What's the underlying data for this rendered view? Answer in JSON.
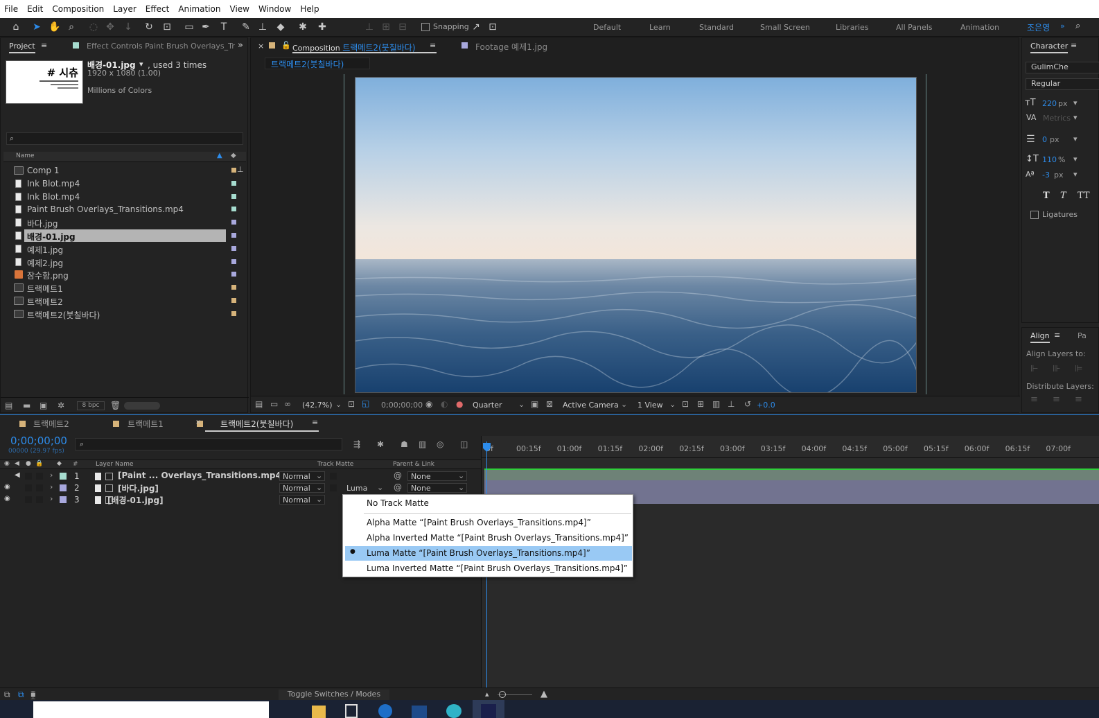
{
  "menu": [
    "File",
    "Edit",
    "Composition",
    "Layer",
    "Effect",
    "Animation",
    "View",
    "Window",
    "Help"
  ],
  "toolbar": {
    "snapping": "Snapping",
    "workspaces": [
      "Default",
      "Learn",
      "Standard",
      "Small Screen",
      "Libraries",
      "All Panels",
      "Animation"
    ],
    "user": "조은영"
  },
  "project": {
    "tab": "Project",
    "effect_tab": "Effect Controls Paint Brush Overlays_Tr",
    "thumb_title": "# 시츄",
    "file_name": "배경-01.jpg",
    "used": ", used 3 times",
    "dims": "1920 x 1080 (1.00)",
    "colors": "Millions of Colors",
    "col_name": "Name",
    "items": [
      {
        "name": "Comp 1",
        "color": "#d6b37a",
        "type": "comp"
      },
      {
        "name": "Ink Blot.mp4",
        "color": "#a6dccf",
        "type": "file"
      },
      {
        "name": "Ink Blot.mp4",
        "color": "#a6dccf",
        "type": "file"
      },
      {
        "name": "Paint Brush Overlays_Transitions.mp4",
        "color": "#a6dccf",
        "type": "file"
      },
      {
        "name": "바다.jpg",
        "color": "#a8a8dd",
        "type": "file"
      },
      {
        "name": "배경-01.jpg",
        "color": "#a8a8dd",
        "type": "file"
      },
      {
        "name": "예제1.jpg",
        "color": "#a8a8dd",
        "type": "file"
      },
      {
        "name": "예제2.jpg",
        "color": "#a8a8dd",
        "type": "file"
      },
      {
        "name": "잠수함.png",
        "color": "#a8a8dd",
        "type": "img"
      },
      {
        "name": "트랙메트1",
        "color": "#d6b37a",
        "type": "comp"
      },
      {
        "name": "트랙메트2",
        "color": "#d6b37a",
        "type": "comp"
      },
      {
        "name": "트랙메트2(붓칠바다)",
        "color": "#d6b37a",
        "type": "comp"
      }
    ],
    "bpc": "8 bpc"
  },
  "comp": {
    "tab_prefix": "Composition",
    "tab_name": "트랙메트2(붓칠바다)",
    "footage_tab": "Footage 예제1.jpg",
    "breadcrumb": "트랙메트2(붓칠바다)",
    "zoom": "(42.7%)",
    "timecode": "0;00;00;00",
    "resolution": "Quarter",
    "camera": "Active Camera",
    "views": "1 View",
    "exposure": "+0.0"
  },
  "character": {
    "tab": "Character",
    "font": "GulimChe",
    "style": "Regular",
    "size": "220",
    "size_unit": "px",
    "kerning": "Metrics",
    "stroke": "0",
    "stroke_unit": "px",
    "scale": "110",
    "scale_unit": "%",
    "baseline": "-3",
    "baseline_unit": "px",
    "ligatures": "Ligatures"
  },
  "align": {
    "tab": "Align",
    "tab2": "Pa",
    "align_to": "Align Layers to:",
    "distribute": "Distribute Layers:"
  },
  "timeline": {
    "tabs": [
      "트랙메트2",
      "트랙메트1",
      "트랙메트2(붓칠바다)"
    ],
    "timecode": "0;00;00;00",
    "fps": "00000 (29.97 fps)",
    "col_layer": "Layer Name",
    "col_track": "Track Matte",
    "col_parent": "Parent & Link",
    "ruler": [
      "0f",
      "00:15f",
      "01:00f",
      "01:15f",
      "02:00f",
      "02:15f",
      "03:00f",
      "03:15f",
      "04:00f",
      "04:15f",
      "05:00f",
      "05:15f",
      "06:00f",
      "06:15f",
      "07:00f"
    ],
    "layers": [
      {
        "num": "1",
        "name": "[Paint ... Overlays_Transitions.mp4]",
        "mode": "Normal",
        "matte": "",
        "parent": "None",
        "color": "#a6dccf"
      },
      {
        "num": "2",
        "name": "[바다.jpg]",
        "mode": "Normal",
        "matte": "Luma",
        "parent": "None",
        "color": "#a8a8dd"
      },
      {
        "num": "3",
        "name": "[배경-01.jpg]",
        "mode": "Normal",
        "matte": "",
        "parent": "",
        "color": "#a8a8dd"
      }
    ],
    "toggle": "Toggle Switches / Modes"
  },
  "dropdown": {
    "items": [
      "No Track Matte",
      "Alpha Matte “[Paint Brush Overlays_Transitions.mp4]”",
      "Alpha Inverted Matte “[Paint Brush Overlays_Transitions.mp4]”",
      "Luma Matte “[Paint Brush Overlays_Transitions.mp4]”",
      "Luma Inverted Matte “[Paint Brush Overlays_Transitions.mp4]”"
    ],
    "selected": "Luma Matte “[Paint Brush Overlays_Transitions.mp4]”"
  },
  "colors": {
    "accent": "#2d8ceb",
    "panel": "#232323",
    "sel": "#99c9f4"
  }
}
